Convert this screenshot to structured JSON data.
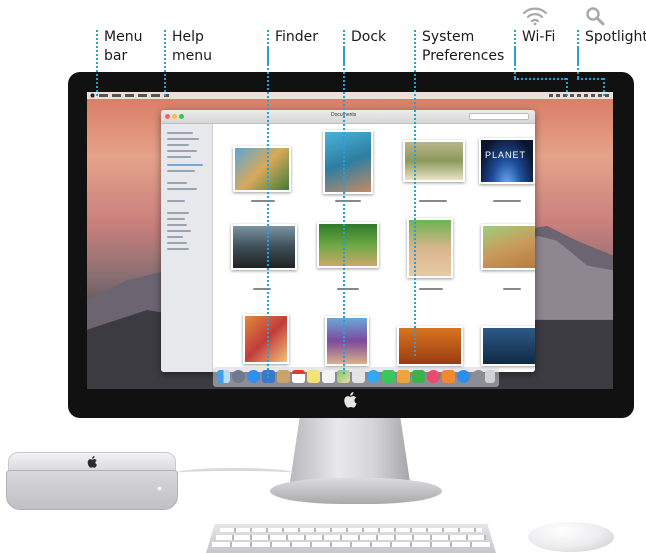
{
  "callouts": {
    "menu_bar_line1": "Menu",
    "menu_bar_line2": "bar",
    "help_menu_line1": "Help",
    "help_menu_line2": "menu",
    "finder": "Finder",
    "dock": "Dock",
    "system_prefs_line1": "System",
    "system_prefs_line2": "Preferences",
    "wifi": "Wi-Fi",
    "spotlight": "Spotlight"
  },
  "icons": {
    "wifi": "wifi-icon",
    "spotlight": "search-icon",
    "apple": "apple-logo-icon"
  },
  "colors": {
    "leader": "#2a9fd6"
  },
  "finder_window": {
    "title": "Documents",
    "planet_caption": "PLANET"
  }
}
